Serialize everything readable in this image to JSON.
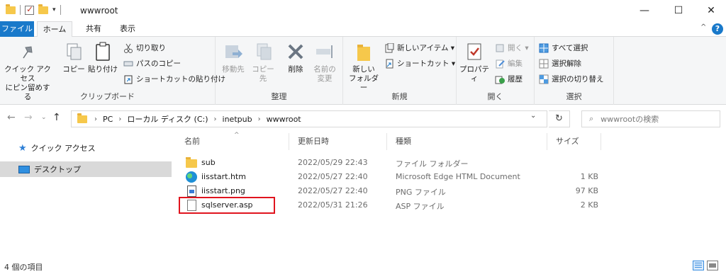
{
  "window": {
    "title": "wwwroot",
    "qat_dropdown": "▾",
    "minimize": "—",
    "maximize": "☐",
    "close": "✕"
  },
  "ribbon_tabs": {
    "file": "ファイル",
    "home": "ホーム",
    "share": "共有",
    "view": "表示",
    "collapse": "^",
    "help": "?"
  },
  "ribbon": {
    "clipboard": {
      "pin": "クイック アクセス\nにピン留めする",
      "copy": "コピー",
      "paste": "貼り付け",
      "cut": "切り取り",
      "copy_path": "パスのコピー",
      "paste_shortcut": "ショートカットの貼り付け",
      "label": "クリップボード"
    },
    "organize": {
      "move_to": "移動先",
      "copy_to": "コピー先",
      "delete": "削除",
      "rename": "名前の\n変更",
      "label": "整理"
    },
    "new": {
      "new_folder": "新しい\nフォルダー",
      "new_item": "新しいアイテム ▾",
      "shortcut": "ショートカット ▾",
      "label": "新規"
    },
    "open": {
      "properties": "プロパティ",
      "open": "開く ▾",
      "edit": "編集",
      "history": "履歴",
      "label": "開く"
    },
    "select": {
      "select_all": "すべて選択",
      "select_none": "選択解除",
      "invert": "選択の切り替え",
      "label": "選択"
    }
  },
  "address": {
    "back": "←",
    "forward": "→",
    "history": "⌄",
    "up": "↑",
    "crumbs": [
      "PC",
      "ローカル ディスク (C:)",
      "inetpub",
      "wwwroot"
    ],
    "separator": "›",
    "dropdown": "⌄",
    "refresh": "↻",
    "search_placeholder": "wwwrootの検索",
    "search_icon": "⌕"
  },
  "nav_pane": {
    "quick_access": "クイック アクセス",
    "desktop": "デスクトップ"
  },
  "file_list": {
    "columns": [
      "名前",
      "更新日時",
      "種類",
      "サイズ"
    ],
    "sort_indicator": "^",
    "rows": [
      {
        "name": "sub",
        "date": "2022/05/29 22:43",
        "type": "ファイル フォルダー",
        "size": "",
        "icon": "folder-icon"
      },
      {
        "name": "iisstart.htm",
        "date": "2022/05/27 22:40",
        "type": "Microsoft Edge HTML Document",
        "size": "1 KB",
        "icon": "edge-icon"
      },
      {
        "name": "iisstart.png",
        "date": "2022/05/27 22:40",
        "type": "PNG ファイル",
        "size": "97 KB",
        "icon": "png-file-icon"
      },
      {
        "name": "sqlserver.asp",
        "date": "2022/05/31 21:26",
        "type": "ASP ファイル",
        "size": "2 KB",
        "icon": "asp-file-icon"
      }
    ],
    "highlight_color": "#e0141e"
  },
  "status": {
    "item_count": "4 個の項目"
  },
  "colors": {
    "accent": "#1979ca",
    "selected_nav": "#d9d9d9"
  }
}
